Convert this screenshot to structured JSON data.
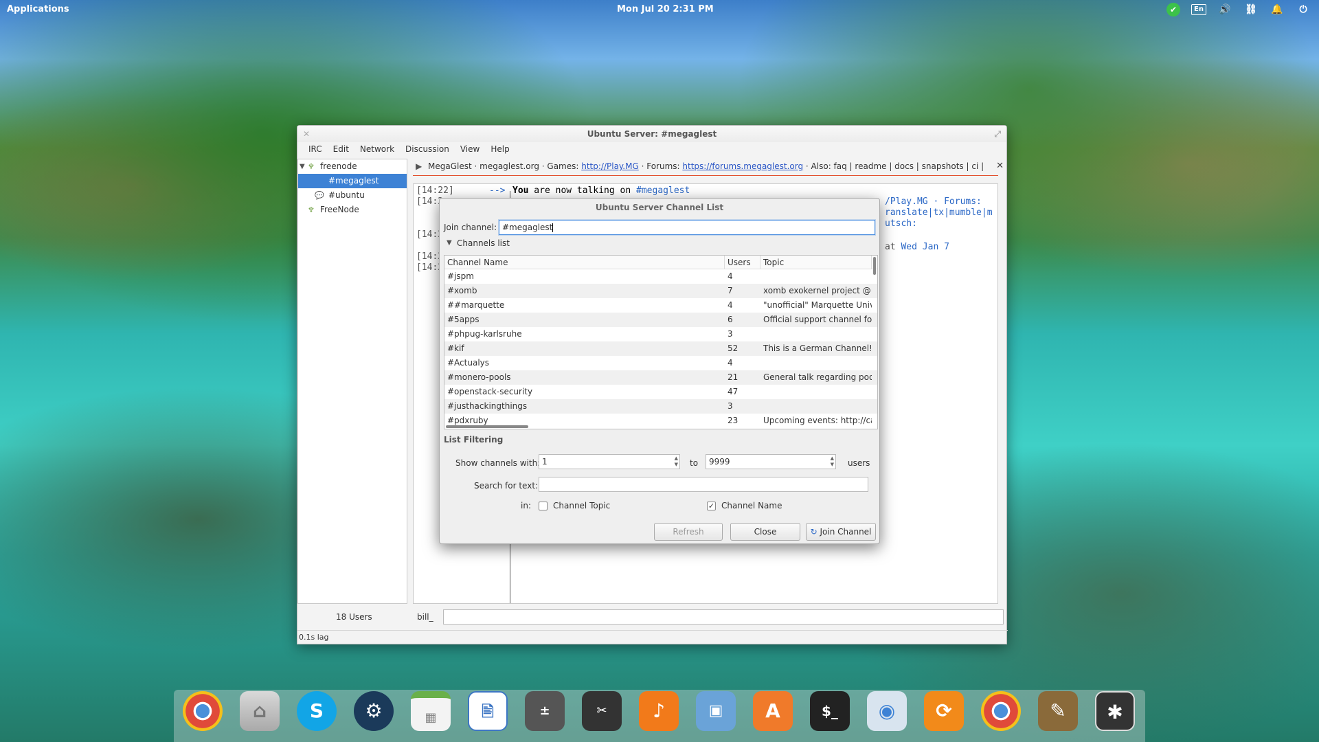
{
  "top_panel": {
    "applications": "Applications",
    "clock": "Mon Jul 20    2:31 PM",
    "lang": "En"
  },
  "window": {
    "title": "Ubuntu Server: #megaglest",
    "menu": [
      "IRC",
      "Edit",
      "Network",
      "Discussion",
      "View",
      "Help"
    ],
    "tree": [
      {
        "label": "freenode",
        "icon": "network-icon"
      },
      {
        "label": "#megaglest",
        "icon": "",
        "selected": true
      },
      {
        "label": "#ubuntu",
        "icon": "channel-icon"
      },
      {
        "label": "FreeNode",
        "icon": "network-icon"
      }
    ],
    "topic": {
      "prefix": "MegaGlest · megaglest.org · Games: ",
      "link1": "http://Play.MG",
      "mid": " · Forums: ",
      "link2": "https://forums.megaglest.org",
      "suffix": " · Also: faq | readme | docs | snapshots | ci | translate | tx | mu..."
    },
    "chat": {
      "line1_time": "[14:22]",
      "line1_arrow": "-->",
      "line1_text_bold": "You",
      "line1_text": " are now talking on ",
      "line1_channel": "#megaglest",
      "line2_time": "[14:2",
      "line3_time": "[14:2",
      "line4_time": "[14:2",
      "line5_time": "[14:2",
      "right1": "/Play.MG · Forums:",
      "right2": "ranslate|tx|mumble|m",
      "right3": "utsch:",
      "right4_pre": "at ",
      "right4_date": "Wed Jan  7"
    },
    "users_count": "18 Users",
    "nick": "bill_",
    "status": "0.1s lag"
  },
  "dialog": {
    "title": "Ubuntu Server Channel List",
    "join_label": "Join channel:",
    "join_value": "#megaglest",
    "channels_list_label": "Channels list",
    "columns": [
      "Channel Name",
      "Users",
      "Topic"
    ],
    "rows": [
      {
        "name": "#jspm",
        "users": "4",
        "topic": ""
      },
      {
        "name": "#xomb",
        "users": "7",
        "topic": "xomb exokernel project @ ww"
      },
      {
        "name": "##marquette",
        "users": "4",
        "topic": "\"unofficial\" Marquette Univer"
      },
      {
        "name": "#5apps",
        "users": "6",
        "topic": "Official support channel for h"
      },
      {
        "name": "#phpug-karlsruhe",
        "users": "3",
        "topic": ""
      },
      {
        "name": "#kif",
        "users": "52",
        "topic": "This is a German Channel! Ple"
      },
      {
        "name": "#Actualys",
        "users": "4",
        "topic": ""
      },
      {
        "name": "#monero-pools",
        "users": "21",
        "topic": "General talk regarding pools a"
      },
      {
        "name": "#openstack-security",
        "users": "47",
        "topic": ""
      },
      {
        "name": "#justhackingthings",
        "users": "3",
        "topic": ""
      },
      {
        "name": "#pdxruby",
        "users": "23",
        "topic": "Upcoming events: http://calag"
      }
    ],
    "filter_heading": "List Filtering",
    "show_label": "Show channels with:",
    "min_users": "1",
    "to_label": "to",
    "max_users": "9999",
    "users_label": "users",
    "search_label": "Search for text:",
    "search_value": "",
    "in_label": "in:",
    "topic_cb_label": "Channel Topic",
    "name_cb_label": "Channel Name",
    "topic_checked": false,
    "name_checked": true,
    "refresh": "Refresh",
    "close": "Close",
    "join": "Join Channel"
  },
  "dock": [
    {
      "name": "chrome-icon",
      "color": "#e04a3a"
    },
    {
      "name": "home-folder-icon",
      "color": "#c9c9c9"
    },
    {
      "name": "skype-icon",
      "color": "#12a5e6"
    },
    {
      "name": "steam-icon",
      "color": "#1b3a5a"
    },
    {
      "name": "calendar-icon",
      "color": "#e8e8e8"
    },
    {
      "name": "document-viewer-icon",
      "color": "#3d76c4"
    },
    {
      "name": "calculator-icon",
      "color": "#555555"
    },
    {
      "name": "screenshot-icon",
      "color": "#333333"
    },
    {
      "name": "music-icon",
      "color": "#f27a1a"
    },
    {
      "name": "photos-icon",
      "color": "#6aa3d8"
    },
    {
      "name": "app-center-icon",
      "color": "#f07a2a"
    },
    {
      "name": "terminal-icon",
      "color": "#222222"
    },
    {
      "name": "switchboard-toggle-icon",
      "color": "#d8e4ef"
    },
    {
      "name": "update-icon",
      "color": "#f28a1a"
    },
    {
      "name": "chromium-icon",
      "color": "#4a90d9"
    },
    {
      "name": "gimp-icon",
      "color": "#8a6a3a"
    },
    {
      "name": "settings-icon",
      "color": "#333333"
    }
  ]
}
